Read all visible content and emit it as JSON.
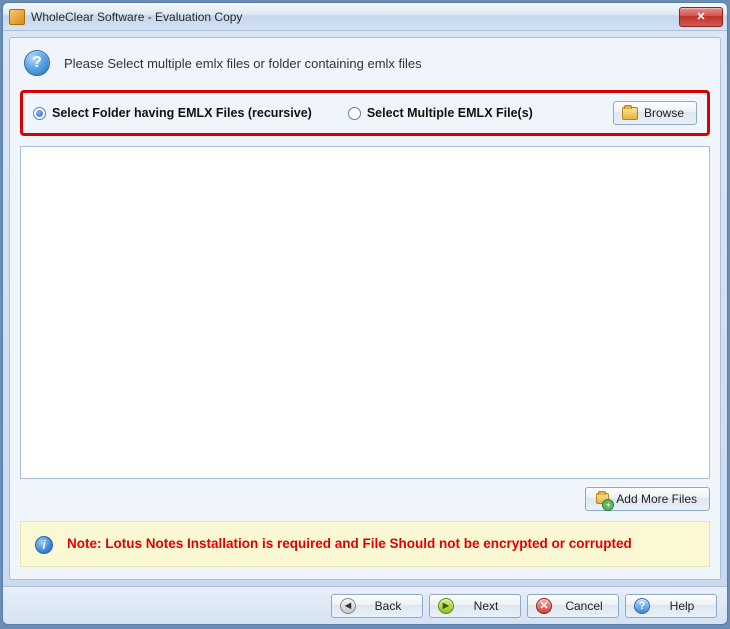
{
  "window": {
    "title": "WholeClear Software - Evaluation Copy"
  },
  "instruction": "Please Select multiple emlx files or folder containing emlx files",
  "options": {
    "folder_label": "Select Folder having EMLX Files (recursive)",
    "files_label": "Select Multiple EMLX File(s)",
    "selected": "folder",
    "browse_label": "Browse"
  },
  "add_more_label": "Add More Files",
  "note": "Note: Lotus Notes Installation is required and File Should not be encrypted or corrupted",
  "footer": {
    "back": "Back",
    "next": "Next",
    "cancel": "Cancel",
    "help": "Help"
  }
}
